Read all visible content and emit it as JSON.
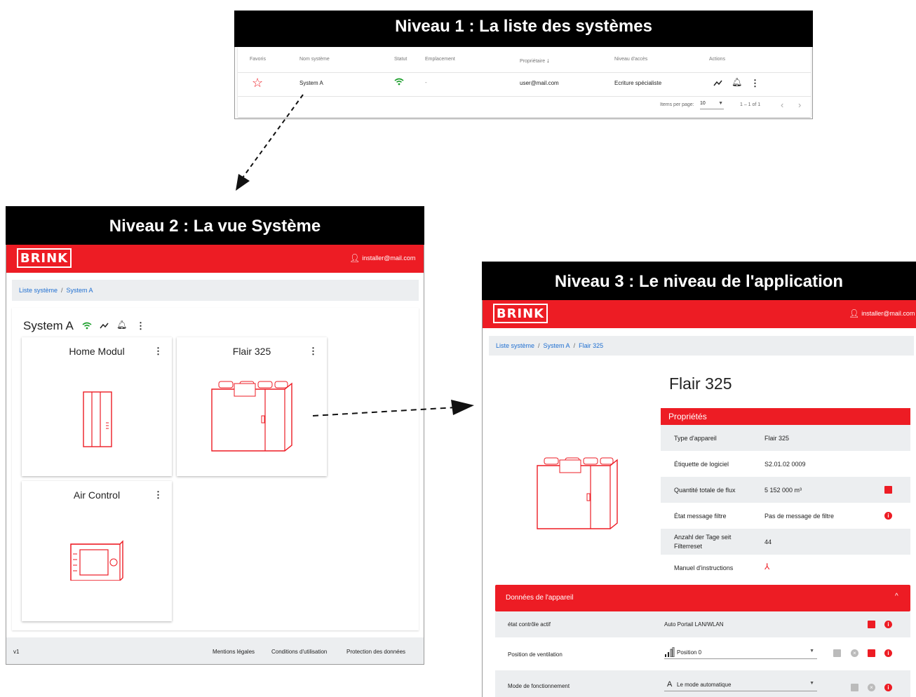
{
  "level1": {
    "title": "Niveau 1 : La liste des systèmes",
    "headers": [
      "Favoris",
      "Nom système",
      "Statut",
      "Emplacement",
      "Propriétaire",
      "Niveau d'accès",
      "Actions"
    ],
    "row": {
      "name": "System A",
      "location": "-",
      "owner": "user@mail.com",
      "access": "Ecriture spécialiste"
    },
    "paginator": {
      "items_label": "Items per page:",
      "items_value": "10",
      "range": "1 – 1 of 1"
    }
  },
  "level2": {
    "title": "Niveau 2 : La vue Système",
    "brand": "BRINK",
    "user": "installer@mail.com",
    "breadcrumb": [
      "Liste système",
      "System A"
    ],
    "system_title": "System A",
    "cards": [
      "Home Modul",
      "Flair 325",
      "Air Control"
    ],
    "footer": {
      "version": "v1",
      "links": [
        "Mentions légales",
        "Conditions d'utilisation",
        "Protection des données"
      ]
    }
  },
  "level3": {
    "title": "Niveau 3 : Le niveau de l'application",
    "brand": "BRINK",
    "user": "installer@mail.com",
    "breadcrumb": [
      "Liste système",
      "System A",
      "Flair 325"
    ],
    "device_title": "Flair 325",
    "properties_header": "Propriétés",
    "properties": [
      {
        "key": "Type d'appareil",
        "value": "Flair 325"
      },
      {
        "key": "Étiquette de logiciel",
        "value": "S2.01.02 0009"
      },
      {
        "key": "Quantité totale de flux",
        "value": "5 152 000 m³"
      },
      {
        "key": "État message filtre",
        "value": "Pas de message de filtre"
      },
      {
        "key": "Anzahl der Tage seit Filterreset",
        "value": "44"
      },
      {
        "key": "Manuel d'instructions",
        "value": ""
      }
    ],
    "device_data_header": "Données de l'appareil",
    "device_data": [
      {
        "key": "état contrôle actif",
        "value": "Auto Portail LAN/WLAN"
      },
      {
        "key": "Position de ventilation",
        "value": "Position 0"
      },
      {
        "key": "Mode de fonctionnement",
        "value": "Le mode automatique"
      }
    ]
  },
  "colors": {
    "brand_red": "#ed1c24",
    "link_blue": "#1f6fd1",
    "status_green": "#1a9e2a"
  }
}
